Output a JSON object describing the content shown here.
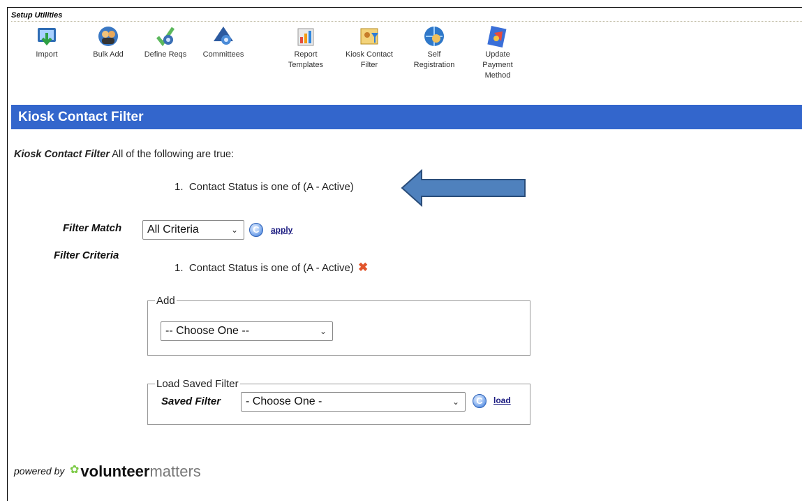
{
  "setup": {
    "header": "Setup Utilities",
    "tools": [
      {
        "label": "Import",
        "icon": "import-icon"
      },
      {
        "label": "Bulk Add",
        "icon": "bulk-add-icon"
      },
      {
        "label": "Define Reqs",
        "icon": "define-reqs-icon"
      },
      {
        "label": "Committees",
        "icon": "committees-icon"
      },
      {
        "label": "Report Templates",
        "icon": "report-templates-icon"
      },
      {
        "label": "Kiosk Contact Filter",
        "icon": "kiosk-contact-filter-icon"
      },
      {
        "label": "Self Registration",
        "icon": "self-registration-icon"
      },
      {
        "label": "Update Payment Method",
        "icon": "update-payment-method-icon"
      }
    ]
  },
  "section": {
    "title": "Kiosk Contact Filter"
  },
  "summary": {
    "name": "Kiosk Contact Filter",
    "text": "All of the following are true:",
    "item": "1.  Contact Status is one of (A - Active)"
  },
  "filter_match": {
    "label": "Filter Match",
    "value": "All Criteria",
    "apply_label": "apply"
  },
  "filter_criteria": {
    "label": "Filter Criteria",
    "item": "1.  Contact Status is one of (A - Active)"
  },
  "add": {
    "legend": "Add",
    "value": "-- Choose One --"
  },
  "load_saved": {
    "legend": "Load Saved Filter",
    "label": "Saved Filter",
    "value": "- Choose One -",
    "load_label": "load"
  },
  "footer": {
    "powered_by": "powered by",
    "brand_strong": "volunteer",
    "brand_light": "matters"
  },
  "colors": {
    "section_bar": "#3366cc",
    "arrow": "#4f81bd",
    "delete_x": "#e2552c"
  }
}
